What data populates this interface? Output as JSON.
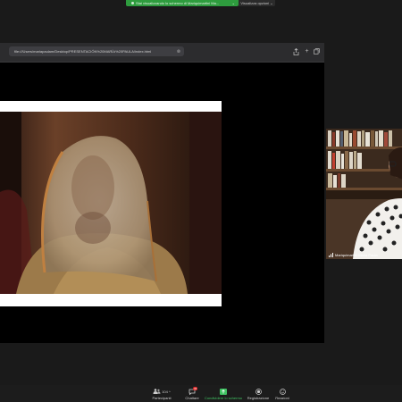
{
  "share_banner": {
    "text": "Stai visualizzando lo schermo di Mariquimartini Ma...",
    "caret": "⌄"
  },
  "view_options": {
    "label": "Visualizza opzioni ⌄"
  },
  "browser": {
    "url": "file:///Users/mariapaulam/Desktop/PRESENTACIÓN%20MARÍA%20PAULA/index.html"
  },
  "participant": {
    "name": "Mariquimartini Maria Paula"
  },
  "toolbar": {
    "participants_label": "Partecipanti",
    "participants_count": "104",
    "chat_label": "Chattare",
    "chat_badge": "34",
    "share_label": "Condividere lo schermo",
    "record_label": "Registrazione",
    "reactions_label": "Reazioni"
  },
  "colors": {
    "share_green": "#2e9c3e",
    "share_text_green": "#40c463",
    "badge_red": "#e02828"
  }
}
